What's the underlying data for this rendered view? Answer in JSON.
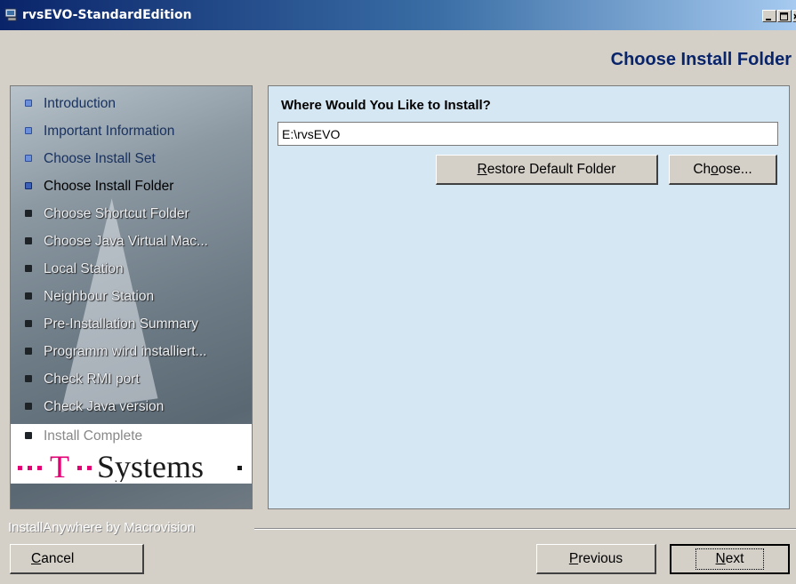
{
  "window": {
    "title": "rvsEVO-StandardEdition",
    "controls": [
      "minimize-icon",
      "maximize-icon",
      "close-icon"
    ]
  },
  "header": {
    "title": "Choose Install Folder"
  },
  "sidebar": {
    "steps": [
      {
        "label": "Introduction",
        "state": "done"
      },
      {
        "label": "Important Information",
        "state": "done"
      },
      {
        "label": "Choose Install Set",
        "state": "done"
      },
      {
        "label": "Choose Install Folder",
        "state": "current"
      },
      {
        "label": "Choose Shortcut Folder",
        "state": "pending"
      },
      {
        "label": "Choose Java Virtual Mac...",
        "state": "pending"
      },
      {
        "label": "Local Station",
        "state": "pending"
      },
      {
        "label": "Neighbour Station",
        "state": "pending"
      },
      {
        "label": "Pre-Installation Summary",
        "state": "pending"
      },
      {
        "label": "Programm wird installiert...",
        "state": "pending"
      },
      {
        "label": "Check RMI port",
        "state": "pending"
      },
      {
        "label": "Check Java version",
        "state": "pending"
      },
      {
        "label": "Install Complete",
        "state": "pending"
      }
    ],
    "logo_text": "T··Systems·"
  },
  "main": {
    "prompt": "Where Would You Like to Install?",
    "folder_value": "E:\\rvsEVO",
    "restore_mnemonic": "R",
    "restore_rest": "estore Default Folder",
    "choose_pre": "Ch",
    "choose_mnemonic": "o",
    "choose_rest": "ose..."
  },
  "footer": {
    "vendor": "InstallAnywhere by Macrovision",
    "cancel_mnemonic": "C",
    "cancel_rest": "ancel",
    "previous_mnemonic": "P",
    "previous_rest": "revious",
    "next_mnemonic": "N",
    "next_rest": "ext"
  },
  "colors": {
    "accent_title": "#0a246a",
    "main_panel_bg": "#d6e7f4",
    "window_bg": "#d4d0c8"
  }
}
